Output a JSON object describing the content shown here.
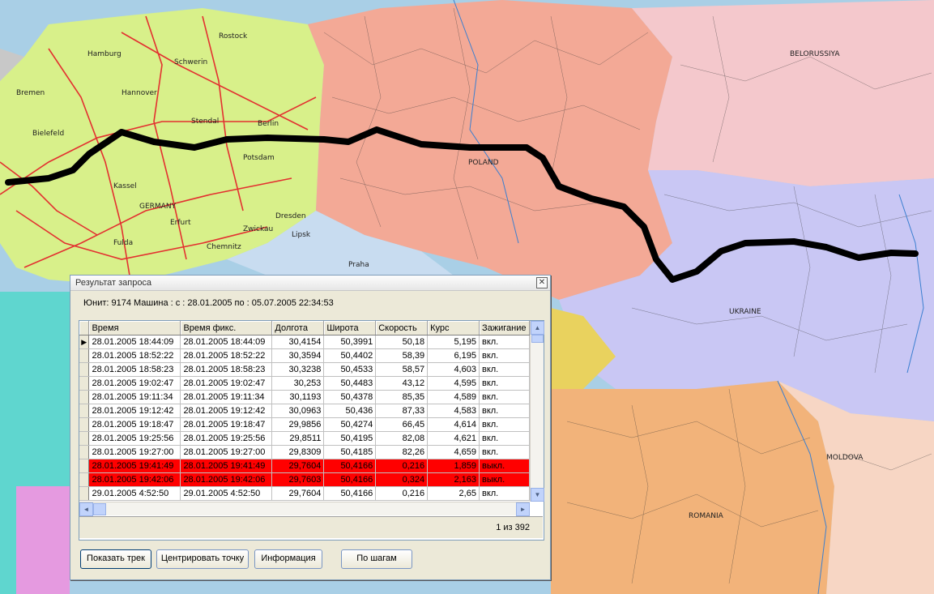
{
  "map": {
    "labels": [
      "Schwerin",
      "Rostock",
      "Hamburg",
      "Hannover",
      "Bielefeld",
      "Kassel",
      "Erfurt",
      "Stendal",
      "Berlin",
      "Dresden",
      "GERMANY",
      "POLAND",
      "BELORUSSIYA",
      "UKRAINE",
      "MOLDOVA",
      "ROMANIA",
      "Bremen",
      "Potsdam",
      "Chemnitz",
      "Praha",
      "Zwickau",
      "Lipsk",
      "Fulda"
    ],
    "colors": {
      "sea": "#a9cfe6",
      "germany": "#d8f08a",
      "poland": "#f3a996",
      "belarus": "#f4c8cc",
      "ukraine": "#c9c7f4",
      "romania": "#f2b37a",
      "czech": "#c8dcf0",
      "track": "#000000",
      "roads": "#e33030"
    }
  },
  "dialog": {
    "title": "Результат запроса",
    "close_glyph": "✕",
    "query_info": "Юнит: 9174 Машина :   с : 28.01.2005 по : 05.07.2005 22:34:53",
    "columns": [
      "Время",
      "Время фикс.",
      "Долгота",
      "Широта",
      "Скорость",
      "Курс",
      "Зажигание"
    ],
    "rows": [
      {
        "time": "28.01.2005 18:44:09",
        "fix": "28.01.2005 18:44:09",
        "lon": "30,4154",
        "lat": "50,3991",
        "speed": "50,18",
        "course": "5,195",
        "ign": "вкл.",
        "current": true
      },
      {
        "time": "28.01.2005 18:52:22",
        "fix": "28.01.2005 18:52:22",
        "lon": "30,3594",
        "lat": "50,4402",
        "speed": "58,39",
        "course": "6,195",
        "ign": "вкл."
      },
      {
        "time": "28.01.2005 18:58:23",
        "fix": "28.01.2005 18:58:23",
        "lon": "30,3238",
        "lat": "50,4533",
        "speed": "58,57",
        "course": "4,603",
        "ign": "вкл."
      },
      {
        "time": "28.01.2005 19:02:47",
        "fix": "28.01.2005 19:02:47",
        "lon": "30,253",
        "lat": "50,4483",
        "speed": "43,12",
        "course": "4,595",
        "ign": "вкл."
      },
      {
        "time": "28.01.2005 19:11:34",
        "fix": "28.01.2005 19:11:34",
        "lon": "30,1193",
        "lat": "50,4378",
        "speed": "85,35",
        "course": "4,589",
        "ign": "вкл."
      },
      {
        "time": "28.01.2005 19:12:42",
        "fix": "28.01.2005 19:12:42",
        "lon": "30,0963",
        "lat": "50,436",
        "speed": "87,33",
        "course": "4,583",
        "ign": "вкл."
      },
      {
        "time": "28.01.2005 19:18:47",
        "fix": "28.01.2005 19:18:47",
        "lon": "29,9856",
        "lat": "50,4274",
        "speed": "66,45",
        "course": "4,614",
        "ign": "вкл."
      },
      {
        "time": "28.01.2005 19:25:56",
        "fix": "28.01.2005 19:25:56",
        "lon": "29,8511",
        "lat": "50,4195",
        "speed": "82,08",
        "course": "4,621",
        "ign": "вкл."
      },
      {
        "time": "28.01.2005 19:27:00",
        "fix": "28.01.2005 19:27:00",
        "lon": "29,8309",
        "lat": "50,4185",
        "speed": "82,26",
        "course": "4,659",
        "ign": "вкл."
      },
      {
        "time": "28.01.2005 19:41:49",
        "fix": "28.01.2005 19:41:49",
        "lon": "29,7604",
        "lat": "50,4166",
        "speed": "0,216",
        "course": "1,859",
        "ign": "выкл.",
        "highlight": true
      },
      {
        "time": "28.01.2005 19:42:06",
        "fix": "28.01.2005 19:42:06",
        "lon": "29,7603",
        "lat": "50,4166",
        "speed": "0,324",
        "course": "2,163",
        "ign": "выкл.",
        "highlight": true
      },
      {
        "time": "29.01.2005 4:52:50",
        "fix": "29.01.2005 4:52:50",
        "lon": "29,7604",
        "lat": "50,4166",
        "speed": "0,216",
        "course": "2,65",
        "ign": "вкл."
      }
    ],
    "record_count": "1 из 392",
    "buttons": {
      "show_track": "Показать трек",
      "center_point": "Центрировать точку",
      "info": "Информация",
      "step_by_step": "По шагам"
    },
    "scroll_glyphs": {
      "up": "▲",
      "down": "▼",
      "left": "◄",
      "right": "►"
    },
    "row_indicator": "▶"
  }
}
